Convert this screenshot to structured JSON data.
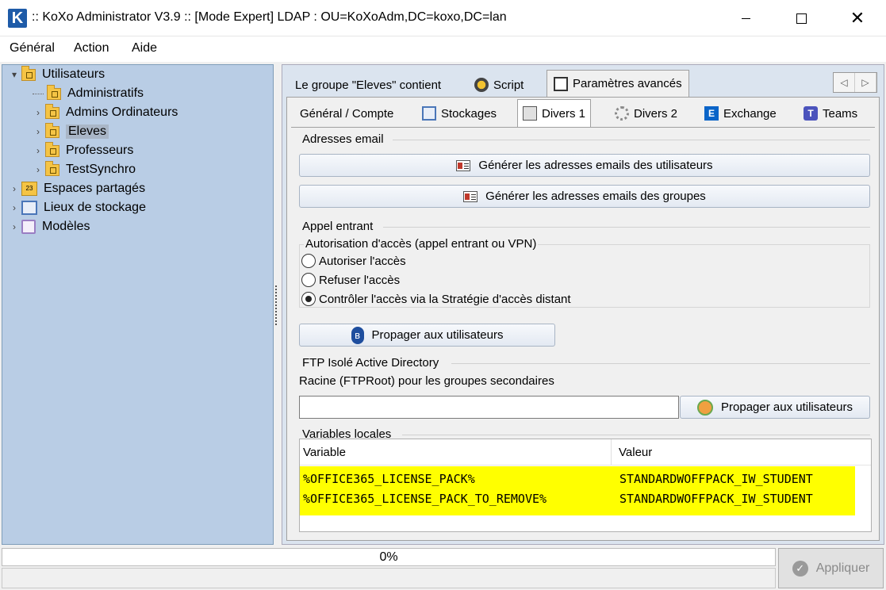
{
  "window": {
    "app_icon_letter": "K",
    "title": ":: KoXo Administrator V3.9 :: [Mode Expert] LDAP : OU=KoXoAdm,DC=koxo,DC=lan",
    "close_glyph": "✕"
  },
  "menu": {
    "items": [
      "Général",
      "Action",
      "Aide"
    ]
  },
  "tree": {
    "root": {
      "label": "Utilisateurs",
      "expander": "▾"
    },
    "children": [
      {
        "label": "Administratifs",
        "expander": ""
      },
      {
        "label": "Admins Ordinateurs",
        "expander": "›"
      },
      {
        "label": "Eleves",
        "expander": "›",
        "selected": true
      },
      {
        "label": "Professeurs",
        "expander": "›"
      },
      {
        "label": "TestSynchro",
        "expander": "›"
      }
    ],
    "others": [
      {
        "label": "Espaces partagés",
        "expander": "›",
        "icon_text": "23"
      },
      {
        "label": "Lieux de stockage",
        "expander": "›"
      },
      {
        "label": "Modèles",
        "expander": "›"
      }
    ]
  },
  "outer_tabs": {
    "items": [
      {
        "label": "Le groupe \"Eleves\" contient"
      },
      {
        "label": "Script"
      },
      {
        "label": "Paramètres avancés",
        "active": true
      }
    ],
    "nav_prev": "◁",
    "nav_next": "▷"
  },
  "inner_tabs": {
    "items": [
      {
        "label": "Général / Compte"
      },
      {
        "label": "Stockages"
      },
      {
        "label": "Divers 1",
        "active": true
      },
      {
        "label": "Divers 2"
      },
      {
        "label": "Exchange"
      },
      {
        "label": "Teams"
      }
    ],
    "exchange_letter": "E",
    "teams_letter": "T"
  },
  "email": {
    "section": "Adresses email",
    "btn_users": "Générer les adresses emails des utilisateurs",
    "btn_groups": "Générer les adresses emails des groupes"
  },
  "dialin": {
    "section": "Appel entrant",
    "group": "Autorisation d'accès (appel entrant ou VPN)",
    "options": [
      {
        "label": "Autoriser l'accès",
        "checked": false
      },
      {
        "label": "Refuser l'accès",
        "checked": false
      },
      {
        "label": "Contrôler l'accès via la Stratégie d'accès distant",
        "checked": true
      }
    ],
    "propagate": "Propager aux utilisateurs",
    "bt_glyph": "ʙ"
  },
  "ftp": {
    "section": "FTP Isolé Active Directory",
    "label": "Racine (FTPRoot) pour les groupes secondaires",
    "value": "",
    "propagate": "Propager aux utilisateurs"
  },
  "vars": {
    "section": "Variables locales",
    "columns": [
      "Variable",
      "Valeur"
    ],
    "rows": [
      {
        "variable": "%OFFICE365_LICENSE_PACK%",
        "value": "STANDARDWOFFPACK_IW_STUDENT"
      },
      {
        "variable": "%OFFICE365_LICENSE_PACK_TO_REMOVE%",
        "value": "STANDARDWOFFPACK_IW_STUDENT"
      }
    ],
    "highlight_color": "#ffff00"
  },
  "footer": {
    "progress": "0%",
    "apply": "Appliquer",
    "apply_glyph": "✓"
  }
}
